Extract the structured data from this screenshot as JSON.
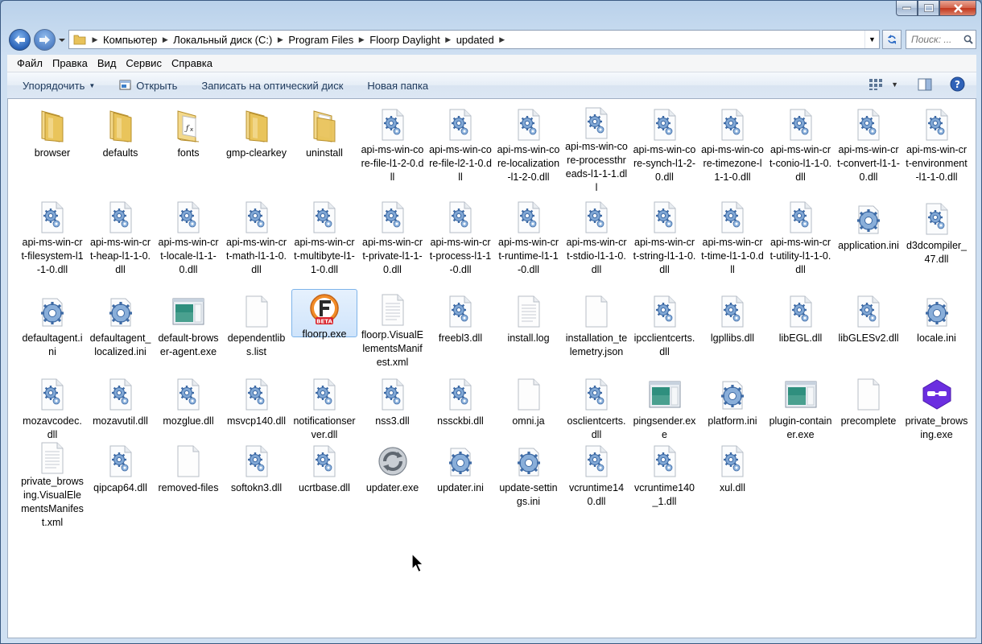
{
  "breadcrumbs": [
    "Компьютер",
    "Локальный диск (C:)",
    "Program Files",
    "Floorp Daylight",
    "updated"
  ],
  "search": {
    "placeholder": "Поиск: ..."
  },
  "menu": [
    "Файл",
    "Правка",
    "Вид",
    "Сервис",
    "Справка"
  ],
  "commands": {
    "organize": "Упорядочить",
    "open": "Открыть",
    "burn": "Записать на оптический диск",
    "new_folder": "Новая папка"
  },
  "colors": {
    "accent": "#2a63b8",
    "selection": "#cfe4fb",
    "folder": "#e8c25a"
  },
  "files": [
    {
      "name": "browser",
      "icon": "folder"
    },
    {
      "name": "defaults",
      "icon": "folder"
    },
    {
      "name": "fonts",
      "icon": "folder-fonts"
    },
    {
      "name": "gmp-clearkey",
      "icon": "folder"
    },
    {
      "name": "uninstall",
      "icon": "folder-open"
    },
    {
      "name": "api-ms-win-core-file-l1-2-0.dll",
      "icon": "dll"
    },
    {
      "name": "api-ms-win-core-file-l2-1-0.dll",
      "icon": "dll"
    },
    {
      "name": "api-ms-win-core-localization-l1-2-0.dll",
      "icon": "dll"
    },
    {
      "name": "api-ms-win-core-processthreads-l1-1-1.dll",
      "icon": "dll"
    },
    {
      "name": "api-ms-win-core-synch-l1-2-0.dll",
      "icon": "dll"
    },
    {
      "name": "api-ms-win-core-timezone-l1-1-0.dll",
      "icon": "dll"
    },
    {
      "name": "api-ms-win-crt-conio-l1-1-0.dll",
      "icon": "dll"
    },
    {
      "name": "api-ms-win-crt-convert-l1-1-0.dll",
      "icon": "dll"
    },
    {
      "name": "api-ms-win-crt-environment-l1-1-0.dll",
      "icon": "dll"
    },
    {
      "name": "api-ms-win-crt-filesystem-l1-1-0.dll",
      "icon": "dll"
    },
    {
      "name": "api-ms-win-crt-heap-l1-1-0.dll",
      "icon": "dll"
    },
    {
      "name": "api-ms-win-crt-locale-l1-1-0.dll",
      "icon": "dll"
    },
    {
      "name": "api-ms-win-crt-math-l1-1-0.dll",
      "icon": "dll"
    },
    {
      "name": "api-ms-win-crt-multibyte-l1-1-0.dll",
      "icon": "dll"
    },
    {
      "name": "api-ms-win-crt-private-l1-1-0.dll",
      "icon": "dll"
    },
    {
      "name": "api-ms-win-crt-process-l1-1-0.dll",
      "icon": "dll"
    },
    {
      "name": "api-ms-win-crt-runtime-l1-1-0.dll",
      "icon": "dll"
    },
    {
      "name": "api-ms-win-crt-stdio-l1-1-0.dll",
      "icon": "dll"
    },
    {
      "name": "api-ms-win-crt-string-l1-1-0.dll",
      "icon": "dll"
    },
    {
      "name": "api-ms-win-crt-time-l1-1-0.dll",
      "icon": "dll"
    },
    {
      "name": "api-ms-win-crt-utility-l1-1-0.dll",
      "icon": "dll"
    },
    {
      "name": "application.ini",
      "icon": "ini"
    },
    {
      "name": "d3dcompiler_47.dll",
      "icon": "dll"
    },
    {
      "name": "defaultagent.ini",
      "icon": "ini"
    },
    {
      "name": "defaultagent_localized.ini",
      "icon": "ini"
    },
    {
      "name": "default-browser-agent.exe",
      "icon": "exe"
    },
    {
      "name": "dependentlibs.list",
      "icon": "file"
    },
    {
      "name": "floorp.exe",
      "icon": "floorp",
      "selected": true
    },
    {
      "name": "floorp.VisualElementsManifest.xml",
      "icon": "text"
    },
    {
      "name": "freebl3.dll",
      "icon": "dll"
    },
    {
      "name": "install.log",
      "icon": "text"
    },
    {
      "name": "installation_telemetry.json",
      "icon": "file"
    },
    {
      "name": "ipcclientcerts.dll",
      "icon": "dll"
    },
    {
      "name": "lgpllibs.dll",
      "icon": "dll"
    },
    {
      "name": "libEGL.dll",
      "icon": "dll"
    },
    {
      "name": "libGLESv2.dll",
      "icon": "dll"
    },
    {
      "name": "locale.ini",
      "icon": "ini"
    },
    {
      "name": "mozavcodec.dll",
      "icon": "dll"
    },
    {
      "name": "mozavutil.dll",
      "icon": "dll"
    },
    {
      "name": "mozglue.dll",
      "icon": "dll"
    },
    {
      "name": "msvcp140.dll",
      "icon": "dll"
    },
    {
      "name": "notificationserver.dll",
      "icon": "dll"
    },
    {
      "name": "nss3.dll",
      "icon": "dll"
    },
    {
      "name": "nssckbi.dll",
      "icon": "dll"
    },
    {
      "name": "omni.ja",
      "icon": "file"
    },
    {
      "name": "osclientcerts.dll",
      "icon": "dll"
    },
    {
      "name": "pingsender.exe",
      "icon": "exe"
    },
    {
      "name": "platform.ini",
      "icon": "ini"
    },
    {
      "name": "plugin-container.exe",
      "icon": "exe"
    },
    {
      "name": "precomplete",
      "icon": "file"
    },
    {
      "name": "private_browsing.exe",
      "icon": "private"
    },
    {
      "name": "private_browsing.VisualElementsManifest.xml",
      "icon": "text"
    },
    {
      "name": "qipcap64.dll",
      "icon": "dll"
    },
    {
      "name": "removed-files",
      "icon": "file"
    },
    {
      "name": "softokn3.dll",
      "icon": "dll"
    },
    {
      "name": "ucrtbase.dll",
      "icon": "dll"
    },
    {
      "name": "updater.exe",
      "icon": "updater"
    },
    {
      "name": "updater.ini",
      "icon": "ini"
    },
    {
      "name": "update-settings.ini",
      "icon": "ini"
    },
    {
      "name": "vcruntime140.dll",
      "icon": "dll"
    },
    {
      "name": "vcruntime140_1.dll",
      "icon": "dll"
    },
    {
      "name": "xul.dll",
      "icon": "dll"
    }
  ]
}
